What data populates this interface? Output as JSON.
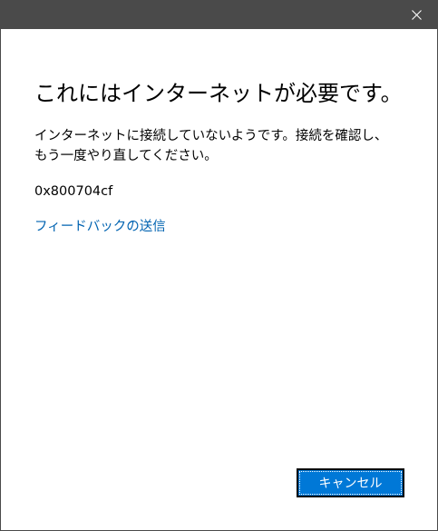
{
  "dialog": {
    "title": "これにはインターネットが必要です。",
    "message_line1": "インターネットに接続していないようです。接続を確認し、",
    "message_line2": "もう一度やり直してください。",
    "error_code": "0x800704cf",
    "feedback_link": "フィードバックの送信",
    "cancel_label": "キャンセル"
  },
  "titlebar": {
    "close_icon": "close-icon"
  },
  "colors": {
    "titlebar": "#4a4a4a",
    "link": "#0063b1",
    "button": "#0078d7",
    "background": "#ffffff"
  }
}
